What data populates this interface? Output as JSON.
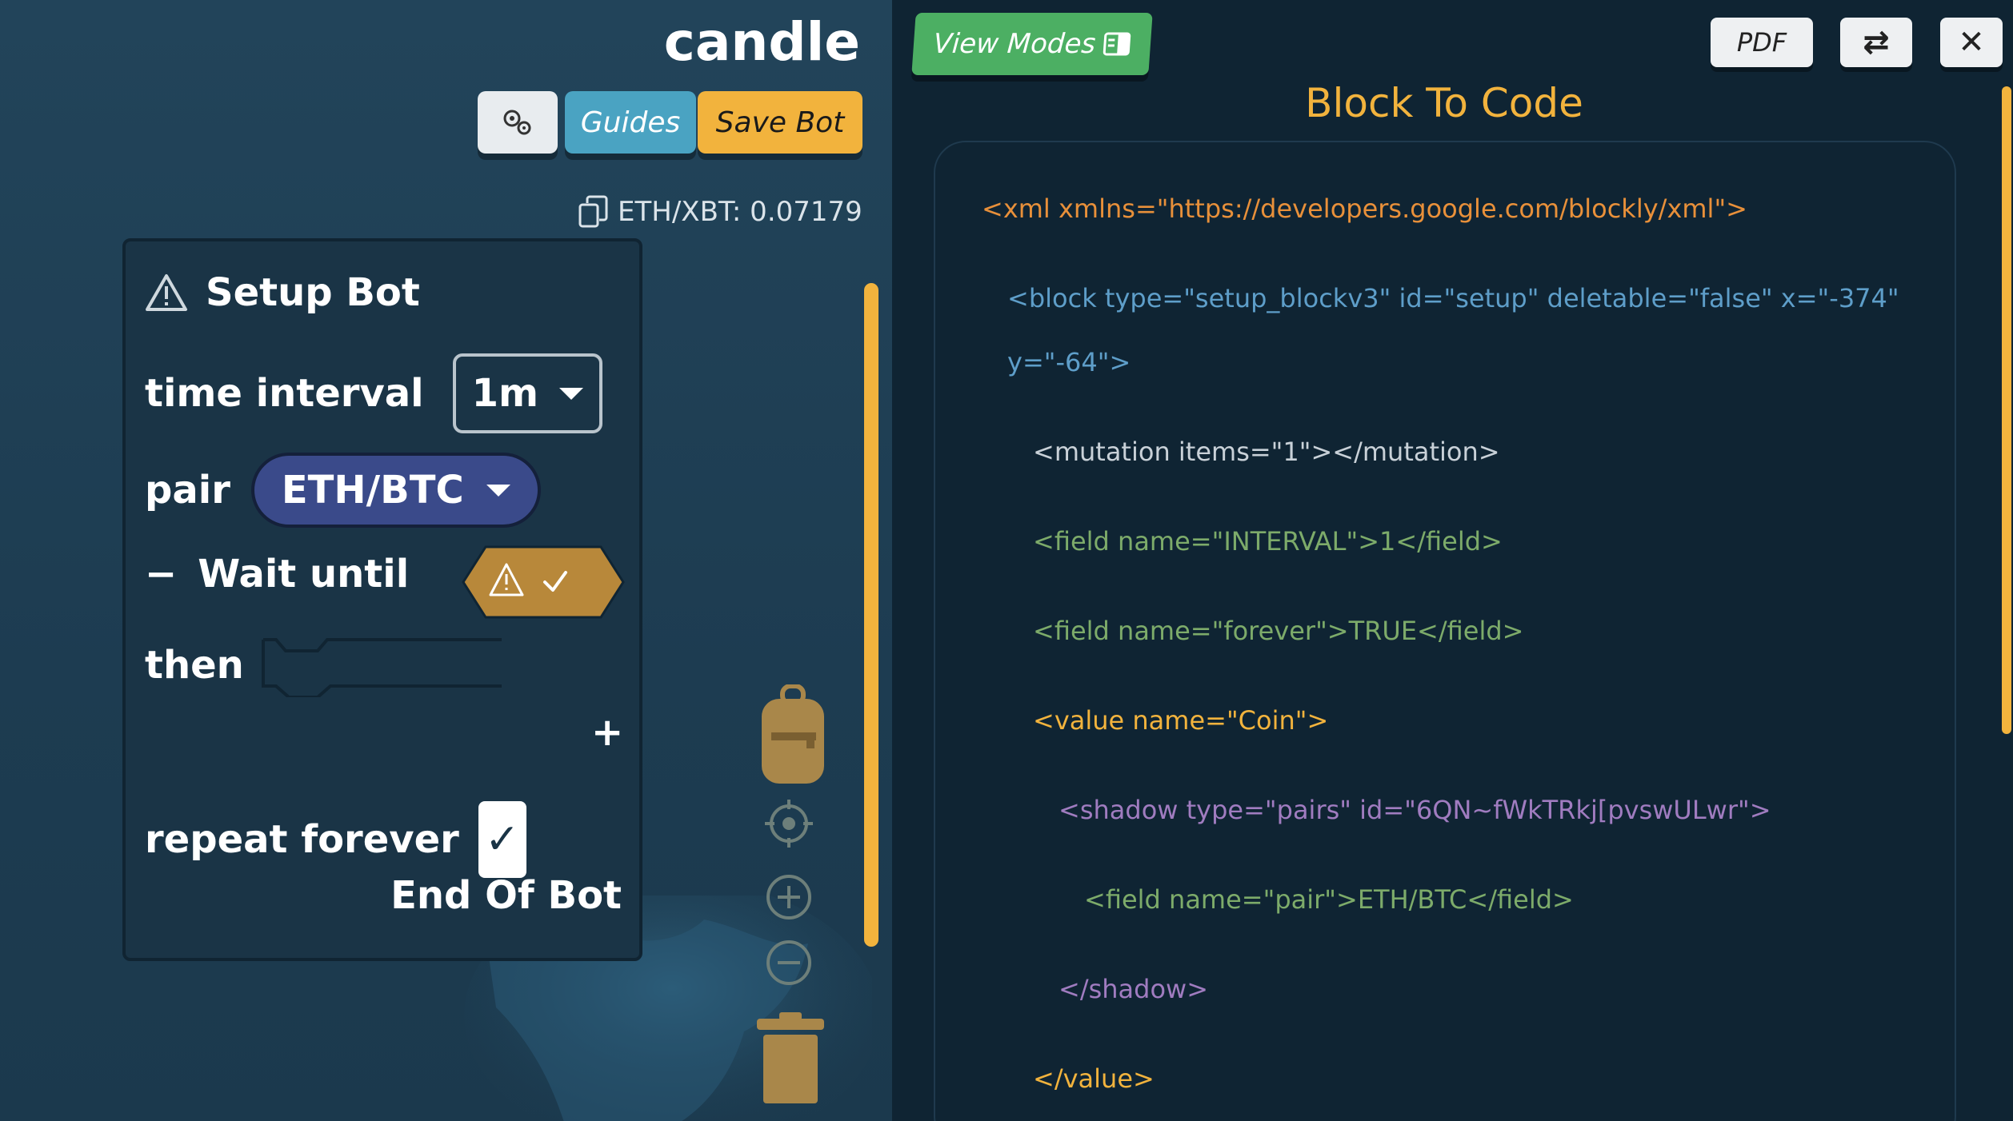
{
  "workspace": {
    "bot_name": "candle",
    "buttons": {
      "guides": "Guides",
      "save": "Save Bot"
    },
    "price_label": "ETH/XBT: 0.07179"
  },
  "block": {
    "title": "Setup Bot",
    "time_interval_label": "time interval",
    "time_interval_value": "1m",
    "pair_label": "pair",
    "pair_value": "ETH/BTC",
    "minus": "−",
    "wait_until_label": "Wait until",
    "then_label": "then",
    "plus": "+",
    "repeat_label": "repeat forever",
    "repeat_checked": "✓",
    "end_label": "End Of Bot"
  },
  "panel": {
    "view_modes": "View Modes",
    "pdf": "PDF",
    "swap": "⇄",
    "close": "✕",
    "title": "Block To Code",
    "code_lines": [
      "<xml xmlns=\"https://developers.google.com/blockly/xml\">",
      "<block type=\"setup_blockv3\" id=\"setup\" deletable=\"false\" x=\"-374\"",
      "y=\"-64\">",
      "<mutation items=\"1\"></mutation>",
      "<field name=\"INTERVAL\">1</field>",
      "<field name=\"forever\">TRUE</field>",
      "<value name=\"Coin\">",
      "<shadow type=\"pairs\" id=\"6QN~fWkTRkj[pvswULwr\">",
      "<field name=\"pair\">ETH/BTC</field>",
      "</shadow>",
      "</value>"
    ]
  },
  "icons": {
    "settings": "gears-icon",
    "copy": "copy-icon",
    "warning": "warning-icon",
    "backpack": "backpack-icon",
    "recenter": "target-icon",
    "zoom_in": "zoom-in-icon",
    "zoom_out": "zoom-out-icon",
    "trash": "trash-icon",
    "view_modes": "panel-icon"
  }
}
